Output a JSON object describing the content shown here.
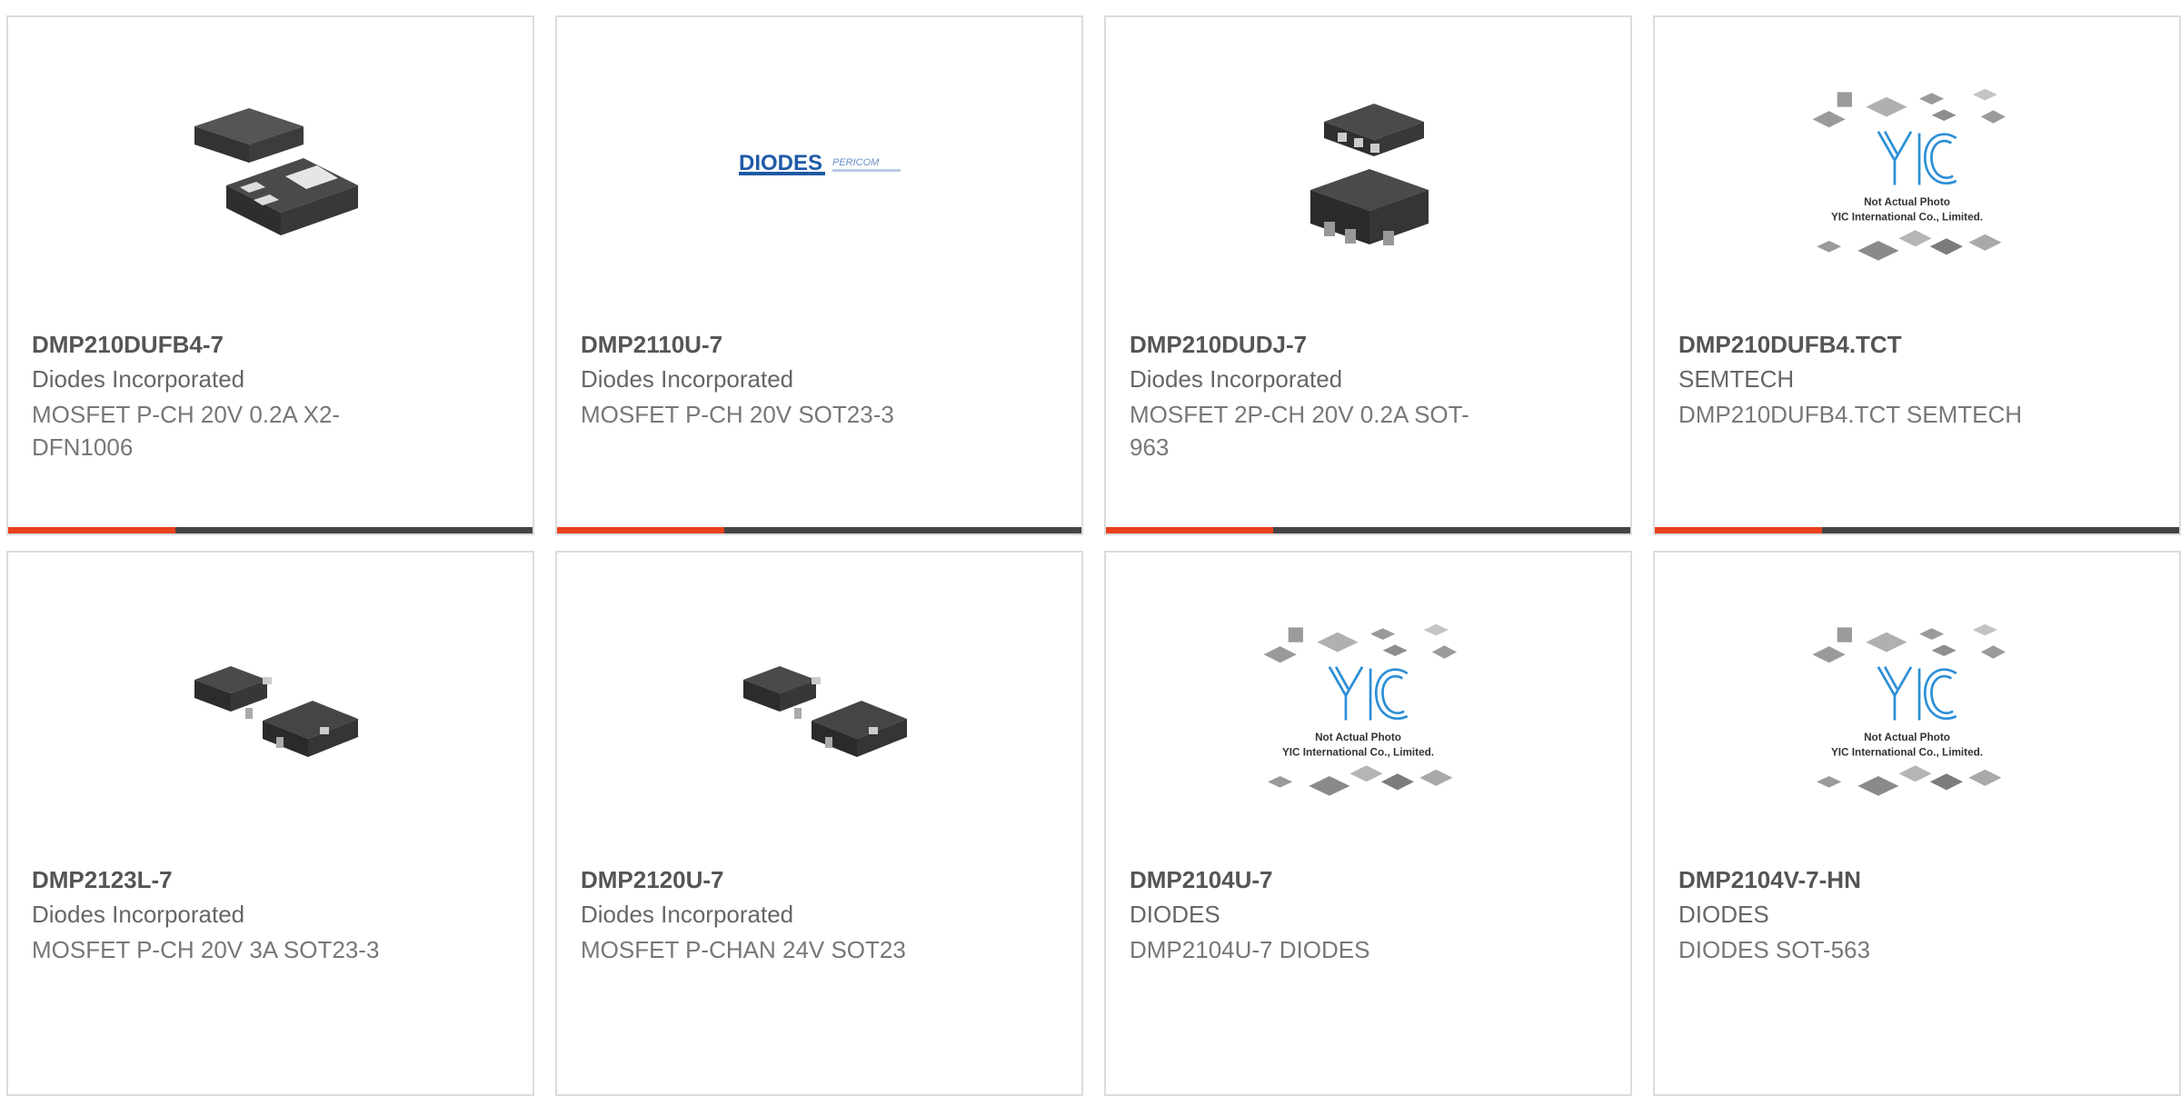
{
  "colors": {
    "accent": "#e8401c",
    "bar": "#444444",
    "border": "#dcdcdc"
  },
  "products": [
    {
      "part_number": "DMP210DUFB4-7",
      "manufacturer": "Diodes Incorporated",
      "description": "MOSFET P-CH 20V 0.2A X2-DFN1006",
      "image": "dfn-package-image"
    },
    {
      "part_number": "DMP2110U-7",
      "manufacturer": "Diodes Incorporated",
      "description": "MOSFET P-CH 20V SOT23-3",
      "image": "diodes-logo-image",
      "logo_text": "DIODES",
      "logo_sub": "PERICOM"
    },
    {
      "part_number": "DMP210DUDJ-7",
      "manufacturer": "Diodes Incorporated",
      "description": "MOSFET 2P-CH 20V 0.2A SOT-963",
      "image": "sot963-package-image"
    },
    {
      "part_number": "DMP210DUFB4.TCT",
      "manufacturer": "SEMTECH",
      "description": "DMP210DUFB4.TCT SEMTECH",
      "image": "placeholder-image",
      "placeholder_line1": "Not Actual Photo",
      "placeholder_line2": "YIC International Co., Limited."
    },
    {
      "part_number": "DMP2123L-7",
      "manufacturer": "Diodes Incorporated",
      "description": "MOSFET P-CH 20V 3A SOT23-3",
      "image": "sot23-package-image"
    },
    {
      "part_number": "DMP2120U-7",
      "manufacturer": "Diodes Incorporated",
      "description": "MOSFET P-CHAN 24V SOT23",
      "image": "sot23-package-image"
    },
    {
      "part_number": "DMP2104U-7",
      "manufacturer": "DIODES",
      "description": "DMP2104U-7 DIODES",
      "image": "placeholder-image",
      "placeholder_line1": "Not Actual Photo",
      "placeholder_line2": "YIC International Co., Limited."
    },
    {
      "part_number": "DMP2104V-7-HN",
      "manufacturer": "DIODES",
      "description": "DIODES SOT-563",
      "image": "placeholder-image",
      "placeholder_line1": "Not Actual Photo",
      "placeholder_line2": "YIC International Co., Limited."
    }
  ]
}
